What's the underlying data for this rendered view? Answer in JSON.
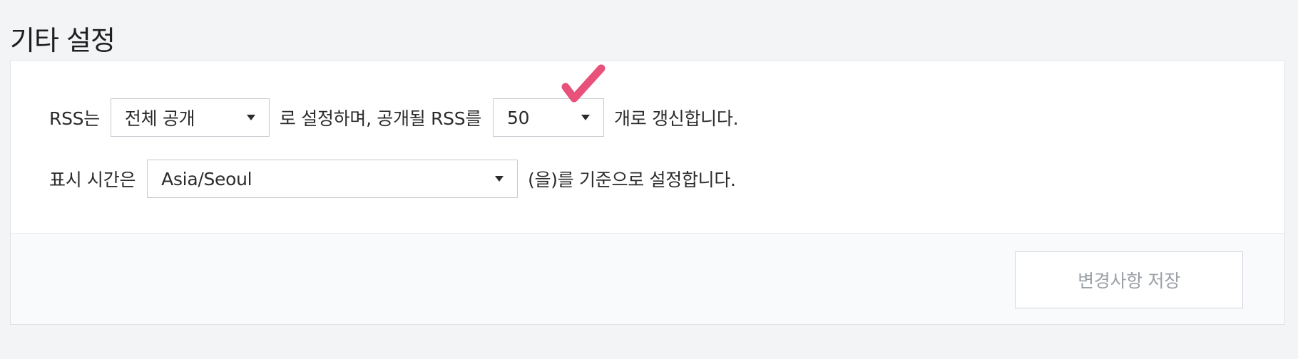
{
  "page": {
    "title": "기타 설정"
  },
  "rss": {
    "prefix": "RSS는",
    "visibility_value": "전체 공개",
    "middle": "로 설정하며, 공개될 RSS를",
    "count_value": "50",
    "suffix": "개로 갱신합니다."
  },
  "timezone": {
    "prefix": "표시 시간은",
    "value": "Asia/Seoul",
    "suffix": "(을)를 기준으로 설정합니다."
  },
  "footer": {
    "save_label": "변경사항 저장"
  },
  "colors": {
    "check_mark": "#e8517a",
    "page_bg": "#f3f4f6",
    "save_text": "#9aa0a6"
  },
  "icons": {
    "check": "check-mark-icon",
    "dropdown": "caret-down-icon"
  }
}
